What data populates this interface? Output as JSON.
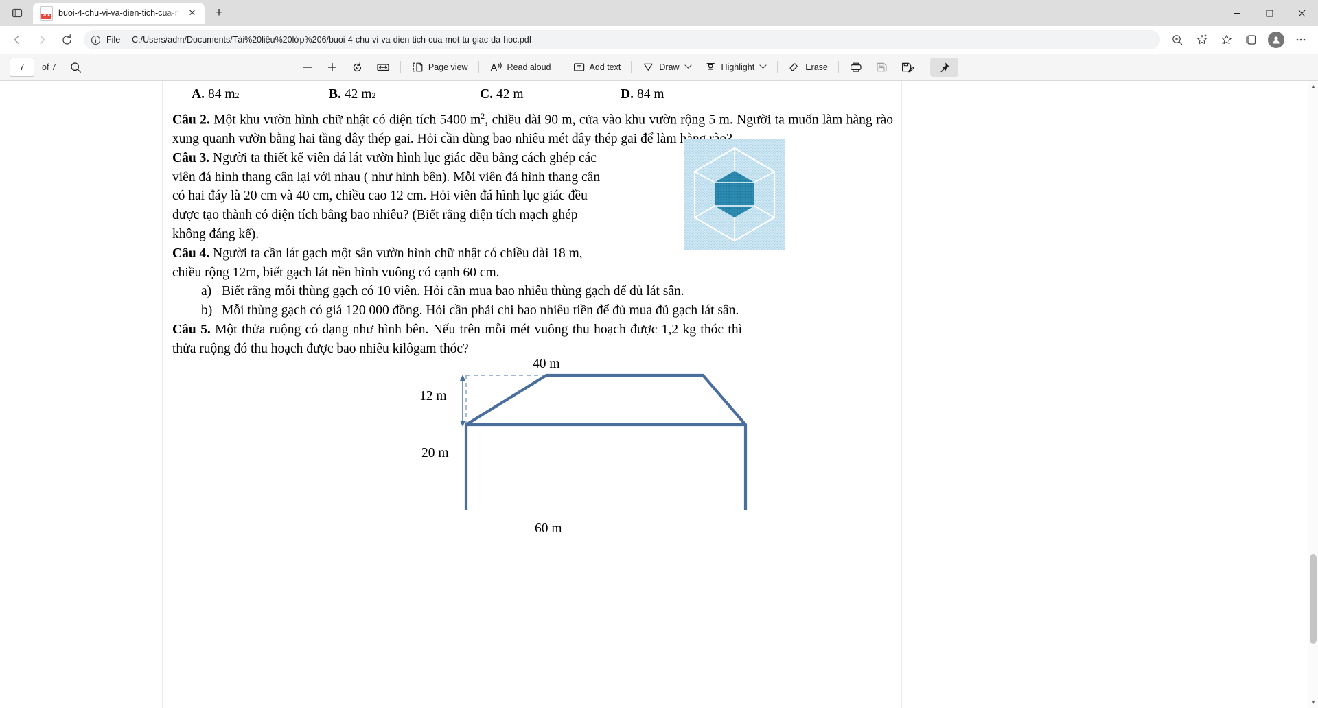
{
  "browser": {
    "tab": {
      "title": "buoi-4-chu-vi-va-dien-tich-cua-m",
      "close_label": "✕",
      "file_type": "PDF"
    },
    "new_tab_label": "+",
    "window": {
      "minimize": "─",
      "maximize": "☐",
      "close": "✕"
    },
    "nav": {
      "back": "←",
      "forward": "→",
      "refresh": "↻"
    },
    "omnibox": {
      "info_icon": "ⓘ",
      "scheme_label": "File",
      "url": "C:/Users/adm/Documents/Tài%20liệu%20lớp%206/buoi-4-chu-vi-va-dien-tich-cua-mot-tu-giac-da-hoc.pdf"
    }
  },
  "pdf_toolbar": {
    "page_current": "7",
    "page_total": "of 7",
    "search_label": "search-icon",
    "zoom_out": "−",
    "zoom_in": "+",
    "rotate": "rotate-icon",
    "fit_width": "fit-to-width-icon",
    "page_view": "Page view",
    "read_aloud": "Read aloud",
    "add_text": "Add text",
    "draw": "Draw",
    "highlight": "Highlight",
    "erase": "Erase",
    "print": "print-icon",
    "save": "save-icon",
    "save_as": "save-as-icon",
    "pin": "pin-icon",
    "chevron": "⌄"
  },
  "document": {
    "options_row": [
      {
        "key": "A.",
        "text": "84 m",
        "sup": "2"
      },
      {
        "key": "B.",
        "text": "42 m",
        "sup": "2"
      },
      {
        "key": "C.",
        "text": "42 m",
        "sup": ""
      },
      {
        "key": "D.",
        "text": "84 m",
        "sup": ""
      }
    ],
    "q2": {
      "label": "Câu 2.",
      "line1_a": " Một khu vườn hình chữ nhật có diện tích 5400 m",
      "line1_sup": "2",
      "line1_b": ", chiều dài 90 m, cửa vào khu vườn rộng 5 m. Người ta muốn làm hàng rào xung quanh vườn bằng hai tầng dây thép gai. Hỏi cần dùng bao nhiêu mét dây thép gai để làm hàng rào?"
    },
    "q3": {
      "label": "Câu 3.",
      "text": " Người ta thiết kế viên đá lát vườn hình lục giác đều bằng cách ghép các viên đá hình thang cân lại với nhau ( như hình bên). Mỗi viên đá hình thang cân có hai đáy là 20 cm và 40 cm, chiều cao 12 cm. Hỏi viên đá hình lục giác đều được tạo thành có diện tích bằng bao nhiêu? (Biết rằng diện tích mạch ghép không đáng kể)."
    },
    "q4": {
      "label": "Câu 4.",
      "text": " Người ta cần lát gạch một sân vườn hình chữ nhật có chiều dài 18 m, chiều rộng 12m, biết gạch lát nền hình vuông có cạnh 60 cm.",
      "items": [
        {
          "marker": "a)",
          "text": "Biết rằng mỗi thùng gạch có 10 viên. Hỏi cần mua bao nhiêu thùng gạch để đủ lát sân."
        },
        {
          "marker": "b)",
          "text": "Mỗi thùng gạch có giá 120 000 đồng. Hỏi cần phải chi bao nhiêu tiền để đủ mua đủ gạch lát sân."
        }
      ]
    },
    "q5": {
      "label": "Câu 5.",
      "text": " Một thửa ruộng có dạng như hình bên. Nếu trên mỗi mét vuông thu hoạch được 1,2 kg thóc thì thửa ruộng đó thu hoạch được bao nhiêu kilôgam thóc?"
    },
    "figure": {
      "top_label": "40 m",
      "height_label": "12 m",
      "side_label": "20 m",
      "bottom_label": "60 m",
      "stroke_color": "#4a6f9c"
    },
    "hex_image": {
      "name": "hexagon-stone-tile-image",
      "bg": "#cde6f2",
      "accent": "#1a7fa8"
    }
  },
  "scrollbar": {
    "up": "▲",
    "down": "▼"
  }
}
